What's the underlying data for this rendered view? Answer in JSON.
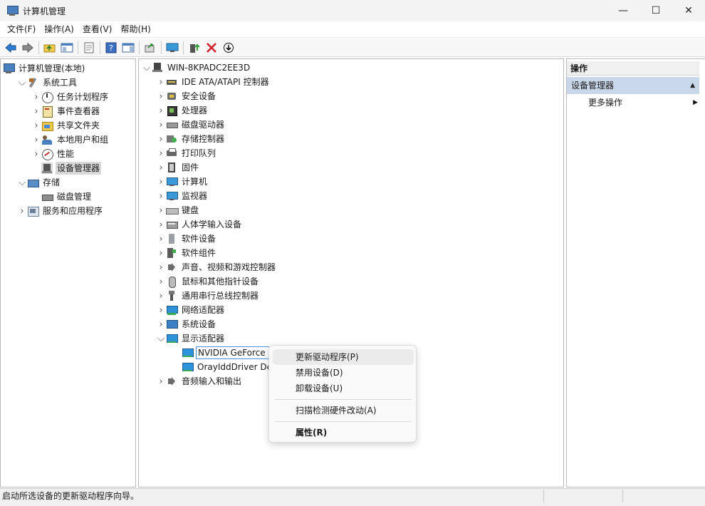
{
  "window": {
    "title": "计算机管理",
    "minimize_glyph": "—",
    "maximize_glyph": "☐",
    "close_glyph": "✕"
  },
  "menu": [
    "文件(F)",
    "操作(A)",
    "查看(V)",
    "帮助(H)"
  ],
  "toolbar": {
    "icons": [
      "back-arrow-icon",
      "forward-arrow-icon",
      "up-folder-icon",
      "show-hide-tree-icon",
      "properties-icon",
      "help-icon",
      "show-action-pane-icon",
      "export-list-icon",
      "scan-monitor-icon",
      "update-driver-icon",
      "uninstall-icon",
      "disable-device-icon"
    ]
  },
  "left_tree": [
    {
      "label": "计算机管理(本地)",
      "indent": 0,
      "chevron": "",
      "icon": "i-root",
      "name": "computer-management-local"
    },
    {
      "label": "系统工具",
      "indent": 1,
      "chevron": "v",
      "icon": "i-tools",
      "name": "system-tools"
    },
    {
      "label": "任务计划程序",
      "indent": 2,
      "chevron": ">",
      "icon": "i-clock",
      "name": "task-scheduler"
    },
    {
      "label": "事件查看器",
      "indent": 2,
      "chevron": ">",
      "icon": "i-event",
      "name": "event-viewer"
    },
    {
      "label": "共享文件夹",
      "indent": 2,
      "chevron": ">",
      "icon": "i-folder",
      "name": "shared-folders"
    },
    {
      "label": "本地用户和组",
      "indent": 2,
      "chevron": ">",
      "icon": "i-users",
      "name": "local-users-groups"
    },
    {
      "label": "性能",
      "indent": 2,
      "chevron": ">",
      "icon": "i-perf",
      "name": "performance"
    },
    {
      "label": "设备管理器",
      "indent": 2,
      "chevron": "",
      "icon": "i-devmgr",
      "name": "device-manager",
      "selected": true
    },
    {
      "label": "存储",
      "indent": 1,
      "chevron": "v",
      "icon": "i-storage",
      "name": "storage"
    },
    {
      "label": "磁盘管理",
      "indent": 2,
      "chevron": "",
      "icon": "i-diskmgr",
      "name": "disk-management"
    },
    {
      "label": "服务和应用程序",
      "indent": 1,
      "chevron": ">",
      "icon": "i-services",
      "name": "services-applications"
    }
  ],
  "device_tree": {
    "root": "WIN-8KPADC2EE3D",
    "categories": [
      {
        "label": "IDE ATA/ATAPI 控制器",
        "icon": "i-ide",
        "name": "ide-controllers"
      },
      {
        "label": "安全设备",
        "icon": "i-security",
        "name": "security-devices"
      },
      {
        "label": "处理器",
        "icon": "i-chip",
        "name": "processors"
      },
      {
        "label": "磁盘驱动器",
        "icon": "i-disk",
        "name": "disk-drives"
      },
      {
        "label": "存储控制器",
        "icon": "i-storagectl",
        "name": "storage-controllers"
      },
      {
        "label": "打印队列",
        "icon": "i-printer",
        "name": "print-queues"
      },
      {
        "label": "固件",
        "icon": "i-firmware",
        "name": "firmware"
      },
      {
        "label": "计算机",
        "icon": "i-monitor",
        "name": "computer"
      },
      {
        "label": "监视器",
        "icon": "i-monitor",
        "name": "monitors"
      },
      {
        "label": "键盘",
        "icon": "i-keyboard",
        "name": "keyboards"
      },
      {
        "label": "人体学输入设备",
        "icon": "i-hid",
        "name": "hid-devices"
      },
      {
        "label": "软件设备",
        "icon": "i-software",
        "name": "software-devices"
      },
      {
        "label": "软件组件",
        "icon": "i-component",
        "name": "software-components"
      },
      {
        "label": "声音、视频和游戏控制器",
        "icon": "i-sound",
        "name": "sound-video-game"
      },
      {
        "label": "鼠标和其他指针设备",
        "icon": "i-mouse",
        "name": "mice-pointing"
      },
      {
        "label": "通用串行总线控制器",
        "icon": "i-usb",
        "name": "usb-controllers"
      },
      {
        "label": "网络适配器",
        "icon": "i-network",
        "name": "network-adapters"
      },
      {
        "label": "系统设备",
        "icon": "i-system",
        "name": "system-devices"
      },
      {
        "label": "显示适配器",
        "icon": "i-gpu",
        "name": "display-adapters",
        "expanded": true
      },
      {
        "label": "音频输入和输出",
        "icon": "i-sound",
        "name": "audio-io"
      }
    ],
    "display_children": [
      {
        "label": "NVIDIA GeForce",
        "name": "nvidia-geforce-device",
        "selected": true
      },
      {
        "label": "OrayIddDriver De",
        "name": "orayidd-driver-device"
      }
    ]
  },
  "actions": {
    "header": "操作",
    "section": "设备管理器",
    "more": "更多操作",
    "up_glyph": "▲",
    "more_glyph": "▶"
  },
  "context_menu": {
    "items": [
      {
        "label": "更新驱动程序(P)",
        "name": "update-driver-item",
        "hover": true
      },
      {
        "label": "禁用设备(D)",
        "name": "disable-device-item"
      },
      {
        "label": "卸载设备(U)",
        "name": "uninstall-device-item"
      },
      {
        "label": "扫描检测硬件改动(A)",
        "name": "scan-hardware-item"
      },
      {
        "label": "属性(R)",
        "name": "properties-item",
        "bold": true
      }
    ]
  },
  "status": {
    "text": "启动所选设备的更新驱动程序向导。"
  }
}
